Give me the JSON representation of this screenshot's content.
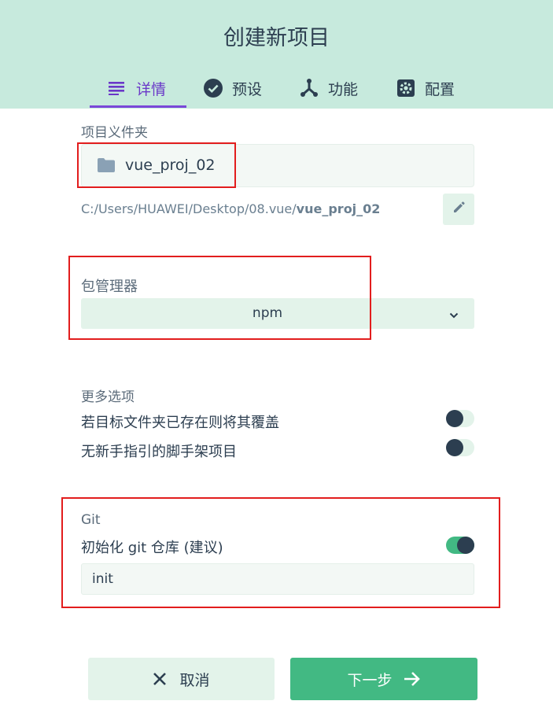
{
  "header": {
    "title": "创建新项目",
    "tabs": [
      {
        "label": "详情",
        "icon": "list-icon",
        "active": true
      },
      {
        "label": "预设",
        "icon": "check-circle-icon",
        "active": false
      },
      {
        "label": "功能",
        "icon": "fork-icon",
        "active": false
      },
      {
        "label": "配置",
        "icon": "gear-icon",
        "active": false
      }
    ]
  },
  "folder": {
    "label": "项目义件夹",
    "name": "vue_proj_02",
    "path_prefix": "C:/Users/HUAWEI/Desktop/08.vue/",
    "path_bold": "vue_proj_02"
  },
  "package_manager": {
    "label": "包管理器",
    "value": "npm"
  },
  "more_options": {
    "label": "更多选项",
    "items": [
      {
        "label": "若目标文件夹已存在则将其覆盖",
        "enabled": false
      },
      {
        "label": "无新手指引的脚手架项目",
        "enabled": false
      }
    ]
  },
  "git": {
    "label": "Git",
    "init_label": "初始化 git 仓库 (建议)",
    "init_enabled": true,
    "commit_message": "init"
  },
  "buttons": {
    "cancel": "取消",
    "next": "下一步"
  },
  "colors": {
    "header_bg": "#c7eadd",
    "accent_purple": "#6a38c8",
    "primary_green": "#42b983",
    "annotation_red": "#e21d1d"
  }
}
